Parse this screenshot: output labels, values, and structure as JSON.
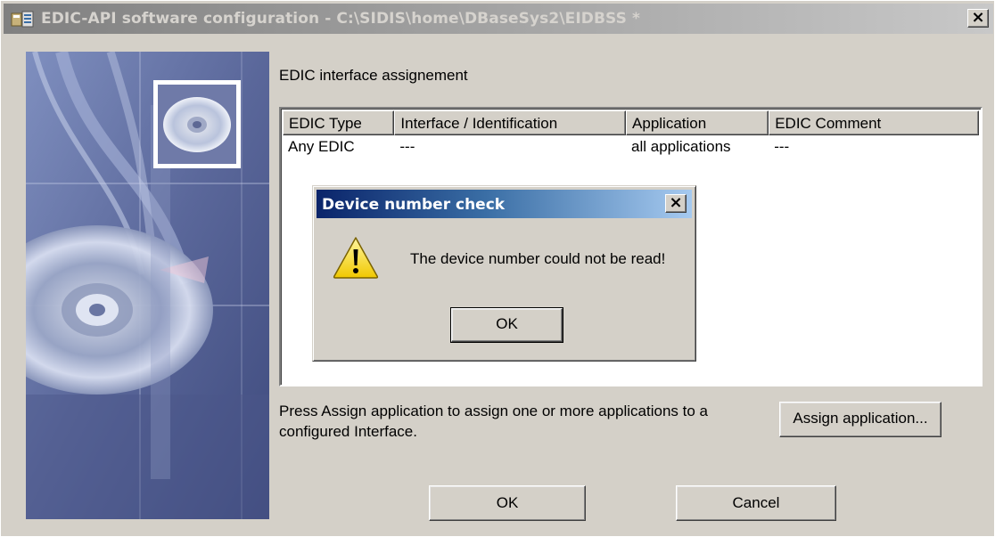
{
  "window": {
    "title": "EDIC-API software configuration - C:\\SIDIS\\home\\DBaseSys2\\EIDBSS *",
    "close_label": "×"
  },
  "main": {
    "section_label": "EDIC interface assignement",
    "table": {
      "columns": [
        "EDIC Type",
        "Interface / Identification",
        "Application",
        "EDIC Comment"
      ],
      "rows": [
        [
          "Any EDIC",
          "---",
          "all applications",
          "---"
        ]
      ]
    },
    "hint": "Press Assign application to assign one or more applications to a configured Interface.",
    "assign_button": "Assign application...",
    "ok_button": "OK",
    "cancel_button": "Cancel"
  },
  "dialog": {
    "title": "Device number check",
    "close_label": "×",
    "icon": "warning-icon",
    "message": "The device number could not be read!",
    "ok_button": "OK"
  },
  "colors": {
    "dialog_title_start": "#0a246a",
    "dialog_title_end": "#a6caf0",
    "inactive_title": "#808080",
    "face": "#d4d0c8"
  }
}
